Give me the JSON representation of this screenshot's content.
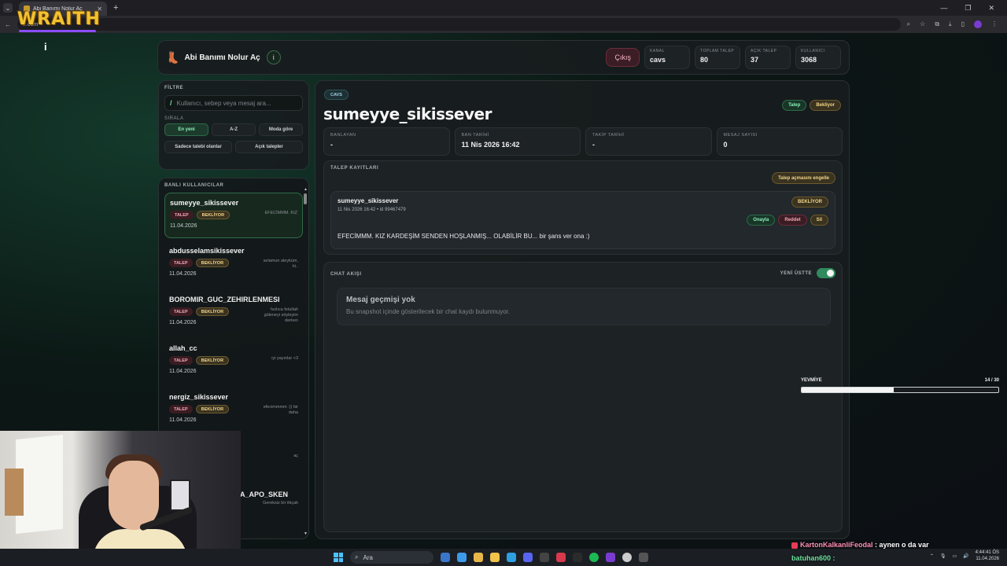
{
  "browser": {
    "tab_title": "Abi Banımı Nolur Aç",
    "url": "…com",
    "overlay_logo": "WRAITH"
  },
  "header": {
    "app_title": "Abi Banımı Nolur Aç",
    "info_label": "i",
    "logout_label": "Çıkış",
    "stats": [
      {
        "label": "KANAL",
        "value": "cavs"
      },
      {
        "label": "TOPLAM TALEP",
        "value": "80"
      },
      {
        "label": "AÇIK TALEP",
        "value": "37"
      },
      {
        "label": "KULLANICI",
        "value": "3068"
      }
    ]
  },
  "filter": {
    "title": "FİLTRE",
    "search_placeholder": "Kullanıcı, sebep veya mesaj ara...",
    "sort_label": "SIRALA",
    "sort_options": [
      "En yeni",
      "A-Z",
      "Moda göre"
    ],
    "filter_options": [
      "Sadece talebi olanlar",
      "Açık talepler"
    ]
  },
  "banned": {
    "title": "BANLI KULLANICILAR",
    "users": [
      {
        "name": "sumeyye_sikissever",
        "talep": "TALEP",
        "status": "BEKLİYOR",
        "date": "11.04.2026",
        "snippet": "EFECİMMM. KIZ"
      },
      {
        "name": "abdusselamsikissever",
        "talep": "TALEP",
        "status": "BEKLİYOR",
        "date": "11.04.2026",
        "snippet": "selamun aleyküm, ki.."
      },
      {
        "name": "BOROMIR_GUC_ZEHIRLENMESI",
        "talep": "TALEP",
        "status": "BEKLİYOR",
        "date": "11.04.2026",
        "snippet": "hızlıca fetullah güleneyi söyleyim derken"
      },
      {
        "name": "allah_cc",
        "talep": "TALEP",
        "status": "BEKLİYOR",
        "date": "11.04.2026",
        "snippet": "iyi yayınlar <3"
      },
      {
        "name": "nergiz_sikissever",
        "talep": "TALEP",
        "status": "BEKLİYOR",
        "date": "11.04.2026",
        "snippet": "efecimmmm :)) bir daha"
      },
      {
        "name": "",
        "talep": "",
        "status": "",
        "date": "",
        "snippet": "aç"
      },
      {
        "name": "A_APO_SKEN",
        "talep": "",
        "status": "",
        "date": "",
        "snippet": "Gereksiz bir itkçak"
      }
    ]
  },
  "main": {
    "channel_pill": "CAVS",
    "username": "sumeyye_sikissever",
    "badge_talep": "Talep",
    "badge_status": "Bekliyor",
    "info": [
      {
        "label": "BANLAYAN",
        "value": "-"
      },
      {
        "label": "BAN TARİHİ",
        "value": "11 Nis 2026 16:42"
      },
      {
        "label": "TAKİP TARİHİ",
        "value": "-"
      },
      {
        "label": "MESAJ SAYISI",
        "value": "0"
      }
    ],
    "requests": {
      "title": "TALEP KAYITLARI",
      "block_label": "Talep açmasını engelle",
      "item": {
        "user": "sumeyye_sikissever",
        "meta": "11 Nis 2026 16:42 • id 99467479",
        "status": "BEKLİYOR",
        "approve": "Onayla",
        "reject": "Reddet",
        "delete": "Sil",
        "message": "EFECİMMM. KIZ KARDEŞİM SENDEN HOŞLANMIŞ... OLABİLİR BU... bir şans ver ona :)"
      }
    },
    "chat": {
      "title": "CHAT AKIŞI",
      "toggle_label": "YENİ ÜSTTE",
      "empty_title": "Mesaj geçmişi yok",
      "empty_sub": "Bu snapshot içinde gösterilecek bir chat kaydı bulunmuyor."
    }
  },
  "overlay": {
    "yevmiye_label": "YEVMİYE",
    "yevmiye_count": "14 / 30",
    "yevmiye_fraction": 0.467,
    "chat_line1_name": "KartonKalkanliFeodal",
    "chat_line1_msg": ": aynen o da var",
    "chat_line2_name": "batuhan600 :"
  },
  "taskbar": {
    "search_label": "Ara",
    "time": "4:44:41 ÖS",
    "date": "11.04.2026"
  }
}
